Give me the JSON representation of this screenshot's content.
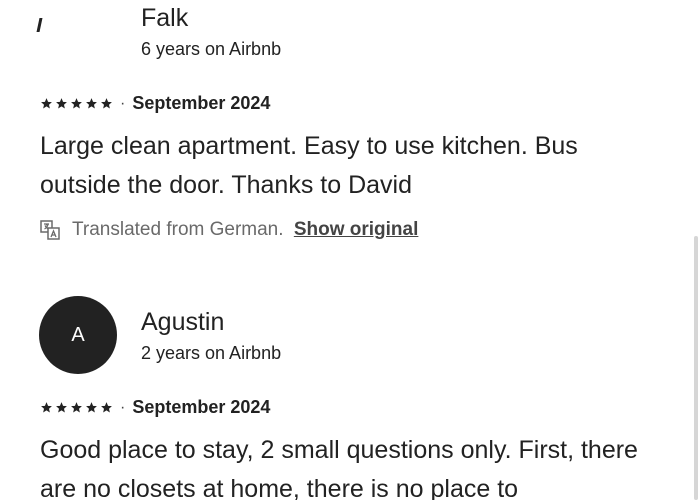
{
  "reviews": [
    {
      "name": "Falk",
      "tenure": "6 years on Airbnb",
      "avatar_letter": "",
      "rating": 5,
      "date": "September 2024",
      "text": "Large clean apartment. Easy to use kitchen. Bus outside the door. Thanks to  David",
      "translated_note": "Translated from German.",
      "show_original_label": "Show original"
    },
    {
      "name": "Agustin",
      "tenure": "2 years on Airbnb",
      "avatar_letter": "A",
      "rating": 5,
      "date": "September 2024",
      "text": "Good place to stay, 2 small questions only. First, there are no closets at home, there is no place to"
    }
  ],
  "separator": "·",
  "icons": {
    "star": "star-icon",
    "translate": "translate-icon"
  },
  "colors": {
    "text": "#222222",
    "muted": "#6a6a6a",
    "avatar_bg": "#222222"
  }
}
